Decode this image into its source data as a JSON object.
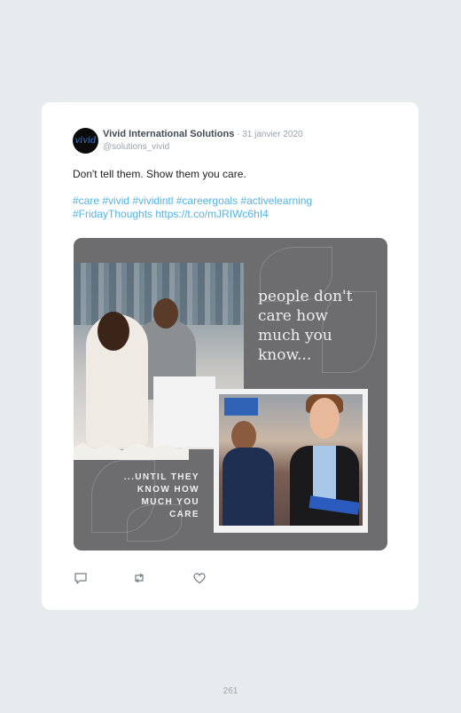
{
  "tweet": {
    "author_name": "Vivid International Solutions",
    "date": " · 31 janvier 2020",
    "handle": "@solutions_vivid",
    "text": "Don't tell them. Show them you care.",
    "hashtags_line1": "#care #vivid #vividintl #careergoals #activelearning",
    "hashtags_line2": "#FridayThoughts https://t.co/mJRIWc6hI4",
    "avatar_text": "vivid"
  },
  "media": {
    "quote_top": "people don't care how much you know...",
    "quote_bottom": "...UNTIL THEY KNOW HOW MUCH YOU CARE"
  },
  "actions": {
    "icons": [
      "reply-icon",
      "retweet-icon",
      "like-icon"
    ]
  },
  "page": {
    "number": "261"
  },
  "colors": {
    "link": "#54b3e3",
    "media_bg": "#6d6d6f",
    "page_bg": "#e6ebee"
  }
}
